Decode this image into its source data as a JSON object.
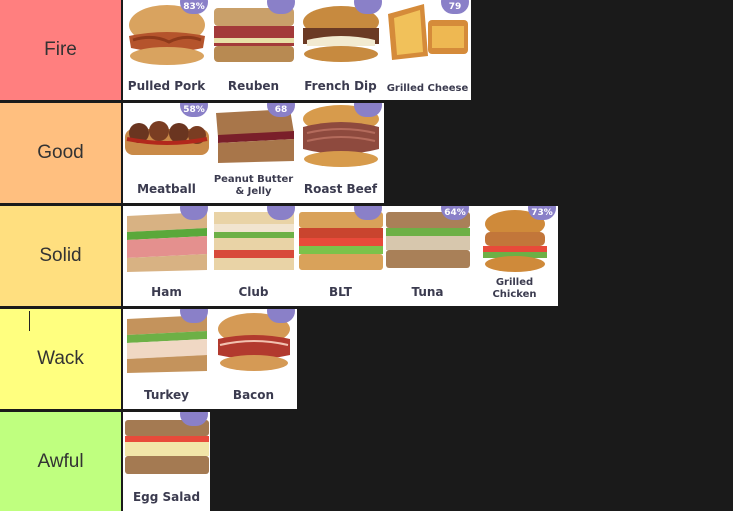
{
  "tiers": [
    {
      "label": "Fire",
      "color": "#ff7f7f",
      "items": [
        {
          "name": "Pulled Pork",
          "badge": "83%"
        },
        {
          "name": "Reuben",
          "badge": ""
        },
        {
          "name": "French Dip",
          "badge": ""
        },
        {
          "name": "Grilled Cheese",
          "badge": "79"
        }
      ]
    },
    {
      "label": "Good",
      "color": "#ffbf7f",
      "items": [
        {
          "name": "Meatball",
          "badge": "58%"
        },
        {
          "name": "Peanut Butter & Jelly",
          "badge": "68"
        },
        {
          "name": "Roast Beef",
          "badge": ""
        }
      ]
    },
    {
      "label": "Solid",
      "color": "#ffdf7f",
      "items": [
        {
          "name": "Ham",
          "badge": ""
        },
        {
          "name": "Club",
          "badge": ""
        },
        {
          "name": "BLT",
          "badge": ""
        },
        {
          "name": "Tuna",
          "badge": "64%"
        },
        {
          "name": "Grilled Chicken",
          "badge": "73%"
        }
      ]
    },
    {
      "label": "Wack",
      "color": "#ffff7f",
      "items": [
        {
          "name": "Turkey",
          "badge": ""
        },
        {
          "name": "Bacon",
          "badge": ""
        }
      ]
    },
    {
      "label": "Awful",
      "color": "#bfff7f",
      "items": [
        {
          "name": "Egg Salad",
          "badge": ""
        }
      ]
    }
  ]
}
